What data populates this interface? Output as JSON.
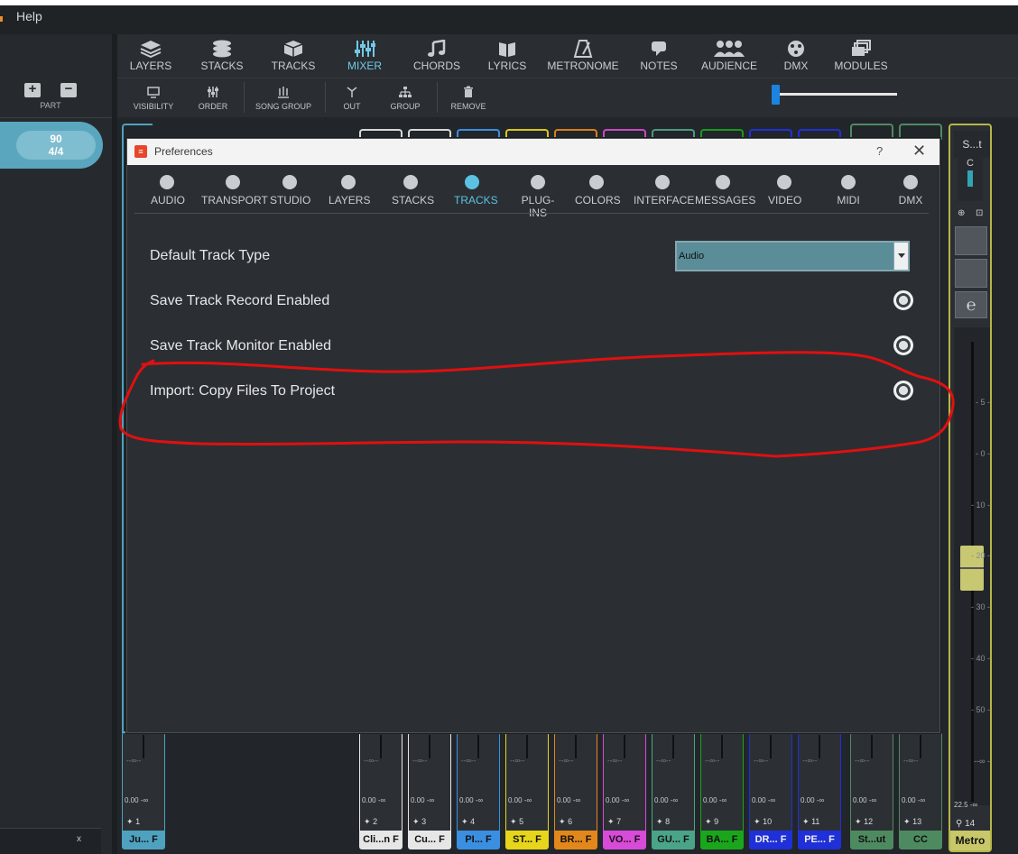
{
  "menu": {
    "help": "Help"
  },
  "left": {
    "part_label": "PART",
    "tempo": "90",
    "signature": "4/4",
    "bottom_x": "x"
  },
  "toolbar": [
    {
      "label": "LAYERS"
    },
    {
      "label": "STACKS"
    },
    {
      "label": "TRACKS"
    },
    {
      "label": "MIXER"
    },
    {
      "label": "CHORDS"
    },
    {
      "label": "LYRICS"
    },
    {
      "label": "METRONOME"
    },
    {
      "label": "NOTES"
    },
    {
      "label": "AUDIENCE"
    },
    {
      "label": "DMX"
    },
    {
      "label": "MODULES"
    }
  ],
  "subtoolbar": [
    {
      "label": "VISIBILITY"
    },
    {
      "label": "ORDER"
    },
    {
      "label": "SONG GROUP"
    },
    {
      "label": "OUT"
    },
    {
      "label": "GROUP"
    },
    {
      "label": "REMOVE"
    }
  ],
  "dialog": {
    "title": "Preferences",
    "help": "?",
    "close": "✕",
    "tabs": [
      {
        "label": "AUDIO"
      },
      {
        "label": "TRANSPORT"
      },
      {
        "label": "STUDIO"
      },
      {
        "label": "LAYERS"
      },
      {
        "label": "STACKS"
      },
      {
        "label": "TRACKS"
      },
      {
        "label": "PLUG-INS"
      },
      {
        "label": "COLORS"
      },
      {
        "label": "INTERFACE"
      },
      {
        "label": "MESSAGES"
      },
      {
        "label": "VIDEO"
      },
      {
        "label": "MIDI"
      },
      {
        "label": "DMX"
      }
    ],
    "settings": {
      "default_track_type": {
        "label": "Default Track Type",
        "value": "Audio"
      },
      "save_record": {
        "label": "Save Track Record Enabled"
      },
      "save_monitor": {
        "label": "Save Track Monitor Enabled"
      },
      "import_copy": {
        "label": "Import: Copy Files To Project"
      }
    }
  },
  "strips": [
    {
      "num": "1",
      "name": "Ju... F",
      "vol": "0.00",
      "inf": "-∞",
      "db": "--∞--",
      "color": "#4ea2bf"
    },
    {
      "num": "2",
      "name": "Cli...n F",
      "vol": "0.00",
      "inf": "-∞",
      "db": "--∞--",
      "color": "#e6e6e6"
    },
    {
      "num": "3",
      "name": "Cu... F",
      "vol": "0.00",
      "inf": "-∞",
      "db": "--∞--",
      "color": "#e6e6e6"
    },
    {
      "num": "4",
      "name": "PI... F",
      "vol": "0.00",
      "inf": "-∞",
      "db": "--∞--",
      "color": "#3a8fe0"
    },
    {
      "num": "5",
      "name": "ST... F",
      "vol": "0.00",
      "inf": "-∞",
      "db": "--∞--",
      "color": "#e6d51a"
    },
    {
      "num": "6",
      "name": "BR... F",
      "vol": "0.00",
      "inf": "-∞",
      "db": "--∞--",
      "color": "#e2871c"
    },
    {
      "num": "7",
      "name": "VO... F",
      "vol": "0.00",
      "inf": "-∞",
      "db": "--∞--",
      "color": "#d84ad8"
    },
    {
      "num": "8",
      "name": "GU... F",
      "vol": "0.00",
      "inf": "-∞",
      "db": "--∞--",
      "color": "#4aa488"
    },
    {
      "num": "9",
      "name": "BA... F",
      "vol": "0.00",
      "inf": "-∞",
      "db": "--∞--",
      "color": "#1aa61a"
    },
    {
      "num": "10",
      "name": "DR... F",
      "vol": "0.00",
      "inf": "-∞",
      "db": "--∞--",
      "color": "#2030d8"
    },
    {
      "num": "11",
      "name": "PE... F",
      "vol": "0.00",
      "inf": "-∞",
      "db": "--∞--",
      "color": "#2030d8"
    },
    {
      "num": "12",
      "name": "St...ut",
      "vol": "0.00",
      "inf": "-∞",
      "db": "--∞--",
      "color": "#4e8a60"
    },
    {
      "num": "13",
      "name": "CC",
      "vol": "0.00",
      "inf": "-∞",
      "db": "--∞--",
      "color": "#4e8a60"
    }
  ],
  "metro": {
    "title": "S...t",
    "channel": "C",
    "vol": "22.5",
    "inf": "-∞",
    "num": "14",
    "name": "Metro",
    "ticks": [
      "5",
      "0",
      "10",
      "20",
      "30",
      "40",
      "50",
      "--∞"
    ]
  }
}
